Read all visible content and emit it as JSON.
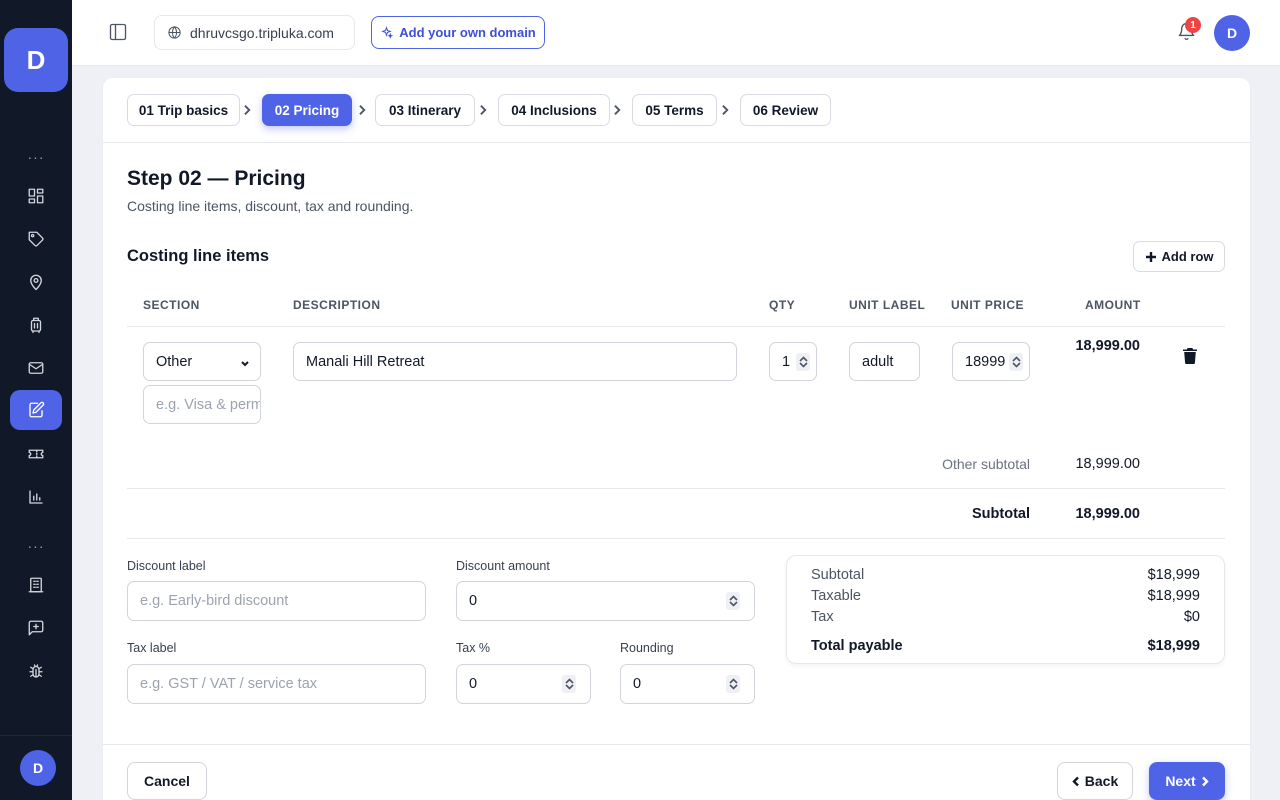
{
  "brand": {
    "letter": "D"
  },
  "sidebar": {
    "items": [
      {
        "name": "dashboard-icon"
      },
      {
        "name": "tag-icon"
      },
      {
        "name": "map-pin-icon"
      },
      {
        "name": "luggage-icon"
      },
      {
        "name": "mail-icon"
      },
      {
        "name": "edit-document-icon",
        "active": true
      },
      {
        "name": "ticket-icon"
      },
      {
        "name": "bar-chart-icon"
      },
      {
        "name": "building-icon"
      },
      {
        "name": "message-plus-icon"
      },
      {
        "name": "bug-icon"
      }
    ],
    "avatar": "D"
  },
  "topbar": {
    "domain": "dhruvcsgo.tripluka.com",
    "add_domain_label": "Add your own domain",
    "notification_count": "1",
    "avatar": "D"
  },
  "steps": [
    {
      "label": "01 Trip basics"
    },
    {
      "label": "02 Pricing",
      "active": true
    },
    {
      "label": "03 Itinerary"
    },
    {
      "label": "04 Inclusions"
    },
    {
      "label": "05 Terms"
    },
    {
      "label": "06 Review"
    }
  ],
  "page": {
    "title": "Step 02 — Pricing",
    "subtitle": "Costing line items, discount, tax and rounding."
  },
  "line_items": {
    "title": "Costing line items",
    "add_row_label": "Add row",
    "columns": [
      "SECTION",
      "DESCRIPTION",
      "QTY",
      "UNIT LABEL",
      "UNIT PRICE",
      "AMOUNT"
    ],
    "rows": [
      {
        "section": "Other",
        "custom_section_placeholder": "e.g. Visa & permits",
        "description": "Manali Hill Retreat",
        "qty": "1",
        "unit_label": "adult",
        "unit_price": "18999",
        "amount": "18,999.00"
      }
    ],
    "other_subtotal_label": "Other subtotal",
    "other_subtotal_value": "18,999.00",
    "subtotal_label": "Subtotal",
    "subtotal_value": "18,999.00"
  },
  "adjustments": {
    "discount_label_label": "Discount label",
    "discount_label_placeholder": "e.g. Early-bird discount",
    "discount_amount_label": "Discount amount",
    "discount_amount_value": "0",
    "tax_label_label": "Tax label",
    "tax_label_placeholder": "e.g. GST / VAT / service tax",
    "tax_percent_label": "Tax %",
    "tax_percent_value": "0",
    "rounding_label": "Rounding",
    "rounding_value": "0"
  },
  "summary": {
    "subtotal_label": "Subtotal",
    "subtotal_value": "$18,999",
    "taxable_label": "Taxable",
    "taxable_value": "$18,999",
    "tax_label": "Tax",
    "tax_value": "$0",
    "total_label": "Total payable",
    "total_value": "$18,999"
  },
  "footer": {
    "cancel_label": "Cancel",
    "back_label": "Back",
    "next_label": "Next"
  },
  "colors": {
    "accent": "#4f63e7",
    "sidebar_bg": "#111827",
    "badge": "#ef4444"
  }
}
